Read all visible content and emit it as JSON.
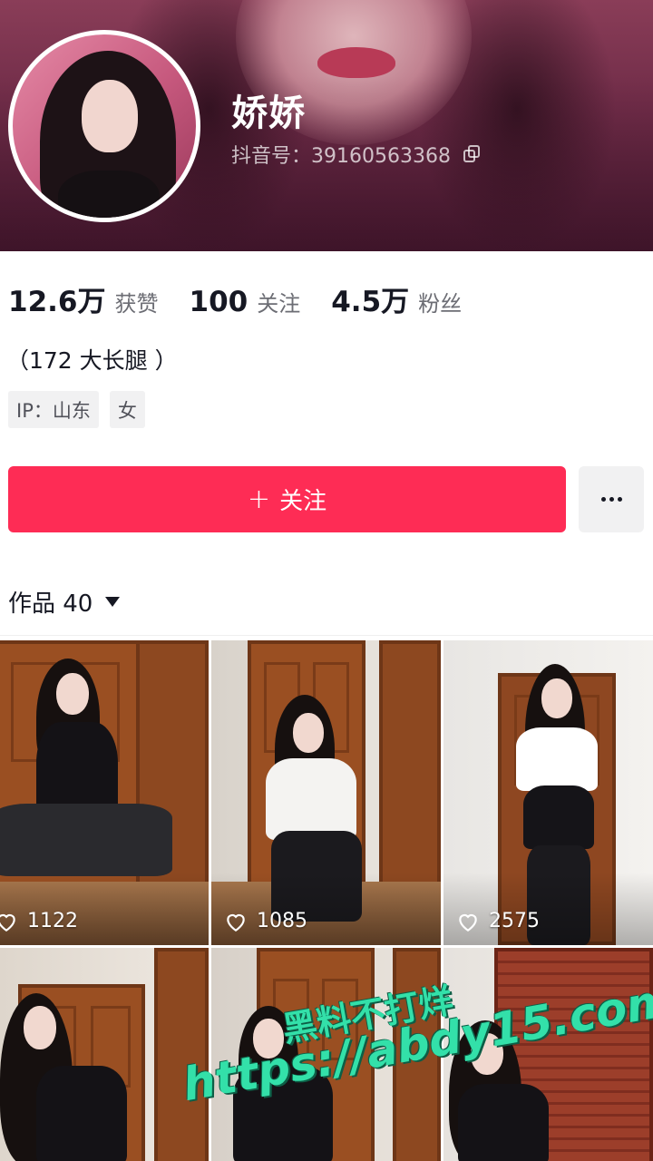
{
  "profile": {
    "nickname": "娇娇",
    "douyin_id": "抖音号：39160563368",
    "bio": "（172  大长腿 ）",
    "tags": [
      "IP：山东",
      "女"
    ]
  },
  "stats": [
    {
      "value": "12.6万",
      "label": "获赞"
    },
    {
      "value": "100",
      "label": "关注"
    },
    {
      "value": "4.5万",
      "label": "粉丝"
    }
  ],
  "actions": {
    "follow_label": "关注",
    "follow_icon": "plus-icon",
    "more_icon": "more-icon"
  },
  "works": {
    "header": "作品 40",
    "items": [
      {
        "likes": "1122"
      },
      {
        "likes": "1085"
      },
      {
        "likes": "2575"
      },
      {
        "likes": ""
      },
      {
        "likes": ""
      },
      {
        "likes": ""
      }
    ]
  },
  "watermark": {
    "line1": "黑料不打烊",
    "line2": "https://abdy15.com"
  },
  "colors": {
    "accent": "#fe2c55",
    "banner": "#6e2b47",
    "watermark": "#33e0a9"
  }
}
